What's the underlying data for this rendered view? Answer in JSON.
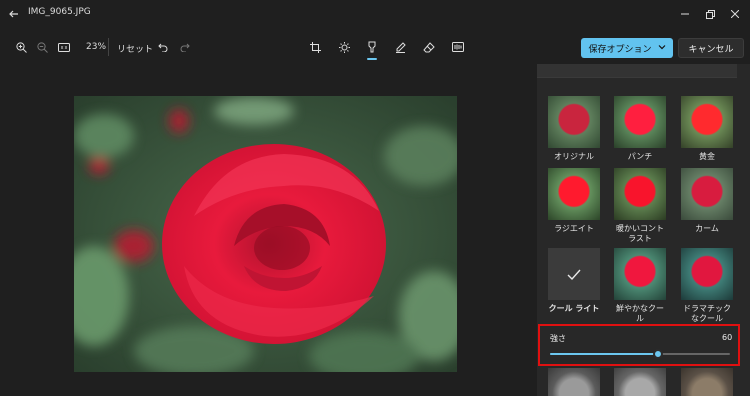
{
  "window": {
    "title": "IMG_9065.JPG"
  },
  "toolbar": {
    "zoom_level": "23%",
    "reset_label": "リセット",
    "save_label": "保存オプション",
    "cancel_label": "キャンセル"
  },
  "filters": [
    {
      "label": "オリジナル",
      "tone": "original"
    },
    {
      "label": "パンチ",
      "tone": "punch"
    },
    {
      "label": "黄金",
      "tone": "golden"
    },
    {
      "label": "ラジエイト",
      "tone": "radiate"
    },
    {
      "label": "暖かいコントラスト",
      "tone": "warm"
    },
    {
      "label": "カーム",
      "tone": "calm"
    },
    {
      "label": "クール ライト",
      "tone": "selected"
    },
    {
      "label": "鮮やかなクール",
      "tone": "vivid"
    },
    {
      "label": "ドラマチックなクール",
      "tone": "dramatic"
    }
  ],
  "strength": {
    "label": "強さ",
    "value": "60",
    "level": 0.6
  },
  "colors": {
    "accent": "#62c3ef",
    "highlight_box": "#e01010"
  }
}
